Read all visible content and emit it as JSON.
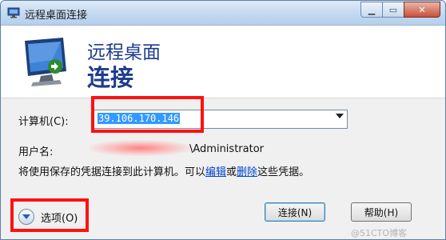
{
  "window": {
    "title": "远程桌面连接"
  },
  "banner": {
    "line1": "远程桌面",
    "line2": "连接"
  },
  "form": {
    "computer_label": "计算机(C):",
    "computer_value": "39.106.170.146",
    "user_label": "用户名:",
    "user_value": "\\Administrator",
    "info_prefix": "将使用保存的凭据连接到此计算机。可以",
    "edit_link": "编辑",
    "info_or": "或",
    "delete_link": "删除",
    "info_suffix": "这些凭据。"
  },
  "buttons": {
    "options": "选项(O)",
    "connect": "连接(N)",
    "help": "帮助(H)"
  },
  "watermark": "@51CTO博客",
  "colors": {
    "highlight_box": "#ff1111",
    "title_blue": "#1e3c8c",
    "link": "#0044cc",
    "selection": "#3399ff"
  }
}
